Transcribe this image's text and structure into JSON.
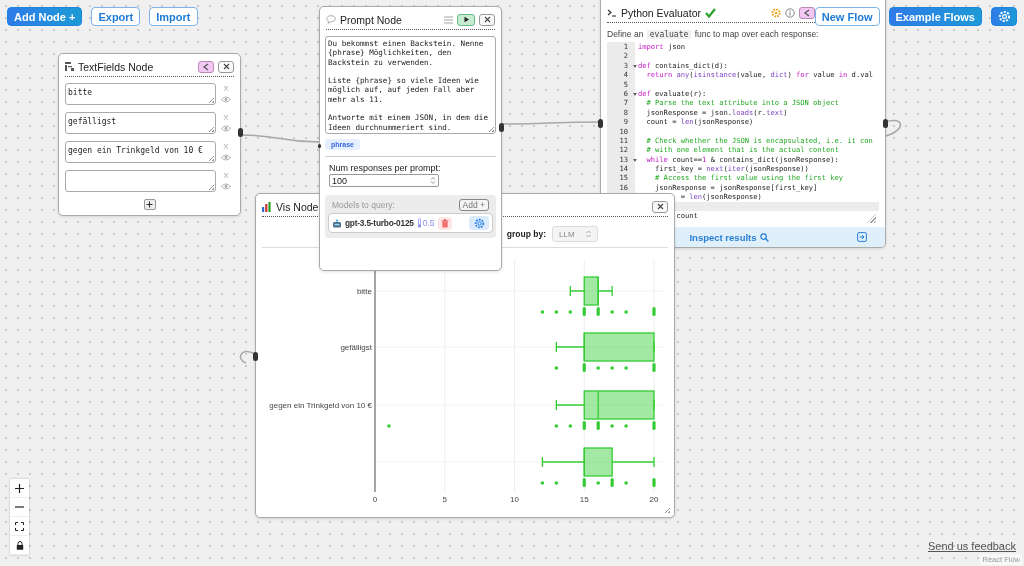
{
  "toolbar_left": [
    {
      "label": "Add Node +",
      "kind": "primary"
    },
    {
      "label": "Export",
      "kind": "outline"
    },
    {
      "label": "Import",
      "kind": "outline"
    }
  ],
  "toolbar_right": [
    {
      "label": "New Flow",
      "kind": "outline"
    },
    {
      "label": "Example Flows",
      "kind": "primary"
    },
    {
      "kind": "settings"
    }
  ],
  "textfields_node": {
    "title": "TextFields Node",
    "fields": [
      {
        "value": "bitte",
        "remove": "X"
      },
      {
        "value": "gefälligst",
        "remove": "X"
      },
      {
        "value": "gegen ein Trinkgeld von 10 €",
        "remove": "X"
      },
      {
        "remove": "X"
      }
    ]
  },
  "prompt_node": {
    "title": "Prompt Node",
    "prompt": "Du bekommst einen Backstein. Nenne {phrase} Möglichkeiten, den Backstein zu verwenden.\n\nListe {phrase} so viele Ideen wie möglich auf, auf jeden Fall aber mehr als 11.\n\nAntworte mit einem JSON, in dem die Ideen durchnummeriert sind.",
    "variables": [
      "phrase"
    ],
    "num_responses_label": "Num responses per prompt:",
    "num_responses": "100",
    "models_label": "Models to query:",
    "add_button": "Add +",
    "models": [
      {
        "name": "gpt-3.5-turbo-0125",
        "temperature": "0.5"
      }
    ]
  },
  "python_node": {
    "title": "Python Evaluator",
    "valid": true,
    "description": [
      {
        "text": "Define an"
      },
      {
        "text": "evaluate",
        "kind": "code"
      },
      {
        "text": "func to map over each response:"
      }
    ],
    "code_lines": [
      {
        "number": "1",
        "parts": [
          {
            "kind": "keyword",
            "text": "import"
          },
          {
            "text": " json"
          }
        ]
      },
      {
        "number": "2"
      },
      {
        "number": "3",
        "foldable": true,
        "parts": [
          {
            "kind": "keyword",
            "text": "def"
          },
          {
            "text": " contains_dict(d):"
          }
        ]
      },
      {
        "number": "4",
        "parts": [
          {
            "kind": "keyword",
            "text": "  return"
          },
          {
            "kind": "builtin",
            "text": " any"
          },
          {
            "text": "("
          },
          {
            "kind": "builtin",
            "text": "isinstance"
          },
          {
            "text": "(value, "
          },
          {
            "kind": "builtin",
            "text": "dict"
          },
          {
            "text": ") "
          },
          {
            "kind": "keyword",
            "text": "for"
          },
          {
            "text": " value "
          },
          {
            "kind": "keyword",
            "text": "in"
          },
          {
            "text": " d.val"
          }
        ]
      },
      {
        "number": "5"
      },
      {
        "number": "6",
        "foldable": true,
        "parts": [
          {
            "kind": "keyword",
            "text": "def"
          },
          {
            "text": " evaluate(r):"
          }
        ]
      },
      {
        "number": "7",
        "parts": [
          {
            "kind": "comment",
            "text": "  # Parse the text attribute into a JSON object"
          }
        ]
      },
      {
        "number": "8",
        "parts": [
          {
            "text": "  jsonResponse = json."
          },
          {
            "kind": "builtin",
            "text": "loads"
          },
          {
            "text": "(r."
          },
          {
            "kind": "builtin",
            "text": "text"
          },
          {
            "text": ")"
          }
        ]
      },
      {
        "number": "9",
        "parts": [
          {
            "text": "  count = "
          },
          {
            "kind": "builtin",
            "text": "len"
          },
          {
            "text": "(jsonResponse)"
          }
        ]
      },
      {
        "number": "10"
      },
      {
        "number": "11",
        "parts": [
          {
            "kind": "comment",
            "text": "  # Check whether the JSON is encapsulated, i.e. it con"
          }
        ]
      },
      {
        "number": "12",
        "parts": [
          {
            "kind": "comment",
            "text": "  # with one element that is the actual content"
          }
        ]
      },
      {
        "number": "13",
        "foldable": true,
        "parts": [
          {
            "kind": "keyword",
            "text": "  while"
          },
          {
            "text": " count=="
          },
          {
            "kind": "keyword",
            "text": "1"
          },
          {
            "text": " & contains_dict(jsonResponse):"
          }
        ]
      },
      {
        "number": "14",
        "parts": [
          {
            "text": "    first_key = "
          },
          {
            "kind": "builtin",
            "text": "next"
          },
          {
            "text": "("
          },
          {
            "kind": "builtin",
            "text": "iter"
          },
          {
            "text": "(jsonResponse))"
          }
        ]
      },
      {
        "number": "15",
        "parts": [
          {
            "kind": "comment",
            "text": "    # Access the first value using the first key"
          }
        ]
      },
      {
        "number": "16",
        "parts": [
          {
            "text": "    jsonResponse = jsonResponse[first_key]"
          }
        ]
      },
      {
        "parts": [
          {
            "text": "          = "
          },
          {
            "kind": "builtin",
            "text": "len"
          },
          {
            "text": "(jsonResponse)"
          }
        ]
      },
      {
        "active": true
      },
      {
        "parts": [
          {
            "text": "         count"
          }
        ]
      }
    ],
    "footer_button": "Inspect results"
  },
  "vis_node": {
    "title": "Vis Node",
    "group_by_label": "group by:",
    "group_by_value": "LLM",
    "plot": {
      "row_labels": [
        "bitte",
        "gefälligst",
        "gegen ein Trinkgeld von 10 €"
      ],
      "x_ticks": [
        "0",
        "5",
        "10",
        "15",
        "20"
      ]
    }
  },
  "feedback_link": "Send us feedback",
  "attribution": "React Flow"
}
